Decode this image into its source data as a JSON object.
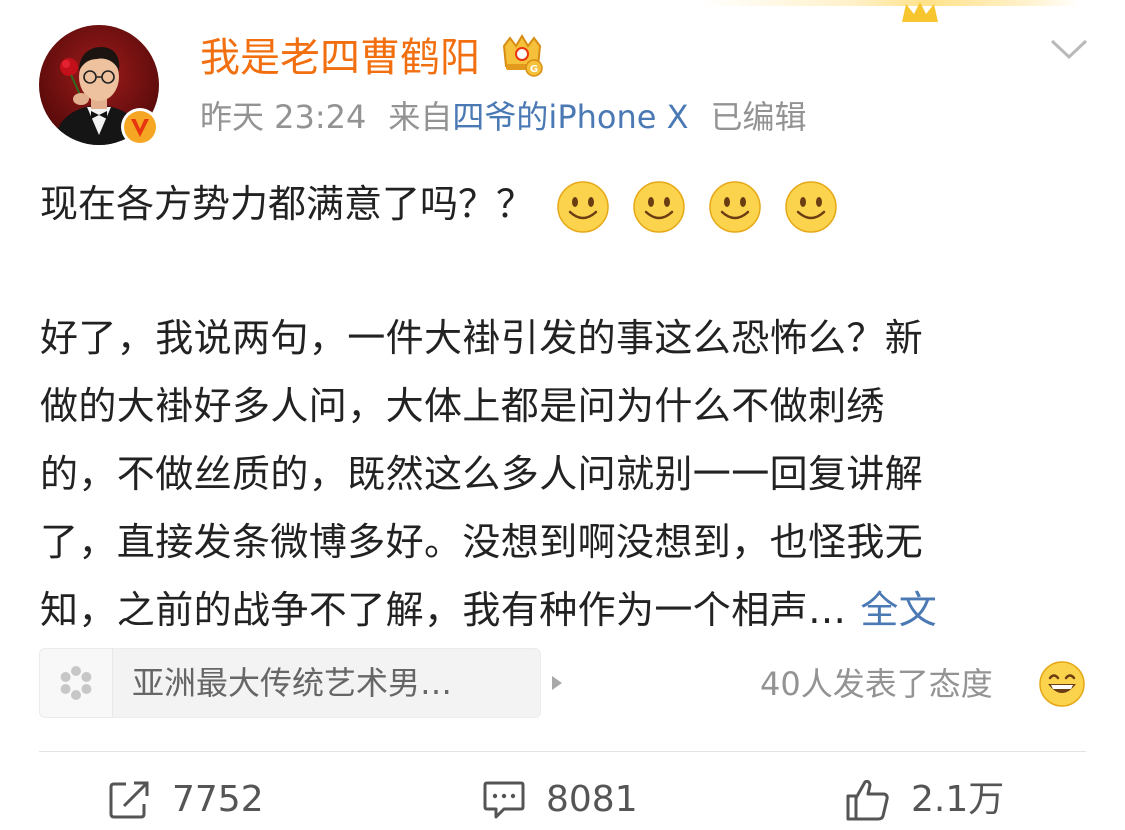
{
  "post": {
    "author": {
      "name": "我是老四曹鹤阳",
      "verified_badge": "v",
      "vip_icon": "crown-g-icon"
    },
    "meta": {
      "time": "昨天 23:24",
      "source_prefix": "来自",
      "source_link": "四爷的iPhone X",
      "edited": "已编辑"
    },
    "line1": "现在各方势力都满意了吗？？",
    "body_lines": [
      "好了，我说两句，一件大褂引发的事这么恐怖么？新",
      "做的大褂好多人问，大体上都是问为什么不做刺绣",
      "的，不做丝质的，既然这么多人问就别一一回复讲解",
      "了，直接发条微博多好。没想到啊没想到，也怪我无"
    ],
    "body_last_line": "知，之前的战争不了解，我有种作为一个相声…",
    "full_text_link": "全文",
    "topic_chip": {
      "label": "亚洲最大传统艺术男…",
      "icon": "topic-pinwheel-icon"
    },
    "attitude_text": "40人发表了态度",
    "actions": {
      "repost_count": "7752",
      "comment_count": "8081",
      "like_count": "2.1万"
    }
  },
  "colors": {
    "username": "#f26f10",
    "link": "#4a79b4",
    "meta_gray": "#939393",
    "badge_bg": "#f5a623",
    "verified": "#e8350f"
  }
}
